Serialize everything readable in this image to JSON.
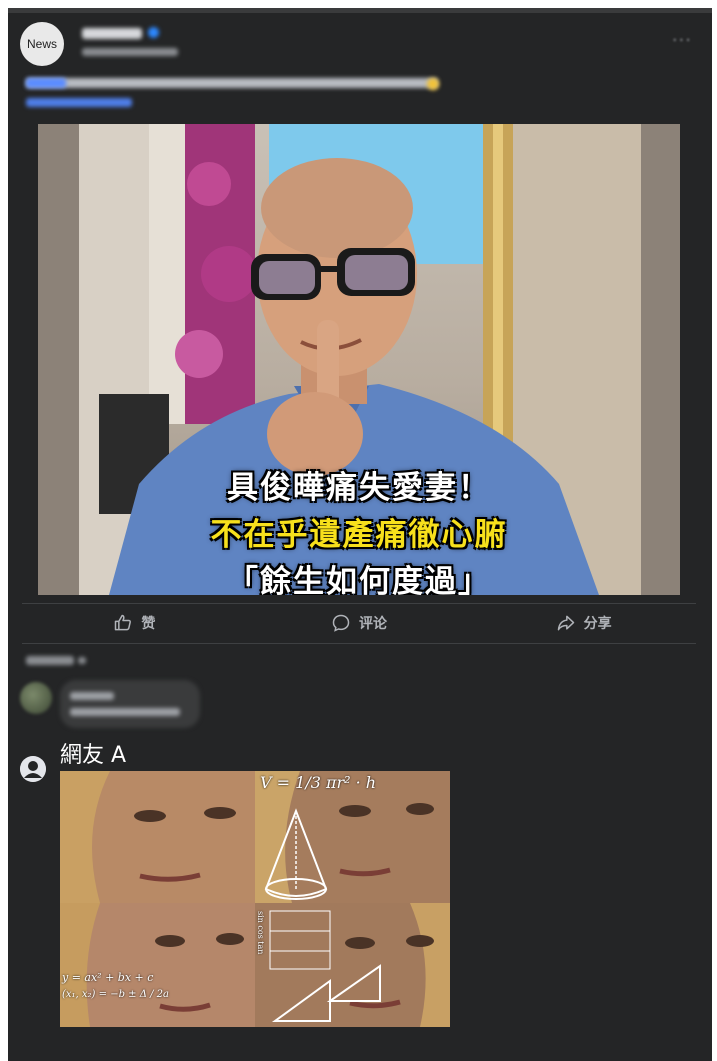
{
  "post": {
    "avatar_label": "News",
    "caption_lines": [
      "具俊曄痛失愛妻！",
      "不在乎遺產痛徹心腑",
      "「餘生如何度過」"
    ],
    "colors": {
      "background": "#242526",
      "caption_highlight": "#f7e01c",
      "verified": "#2d88ff"
    }
  },
  "actions": [
    {
      "label": "赞",
      "icon": "thumbs-up-icon"
    },
    {
      "label": "评论",
      "icon": "comment-icon"
    },
    {
      "label": "分享",
      "icon": "share-icon"
    }
  ],
  "comment": {
    "author": "網友 A",
    "avatar_icon": "user-silhouette-icon",
    "meme_formulas": {
      "cone": "V = 1/3 πr² · h",
      "quadratic": "y = ax² + bx + c",
      "roots": "(x₁, x₂) = −b ± Δ / 2a",
      "trig": "sin cos tan"
    }
  }
}
